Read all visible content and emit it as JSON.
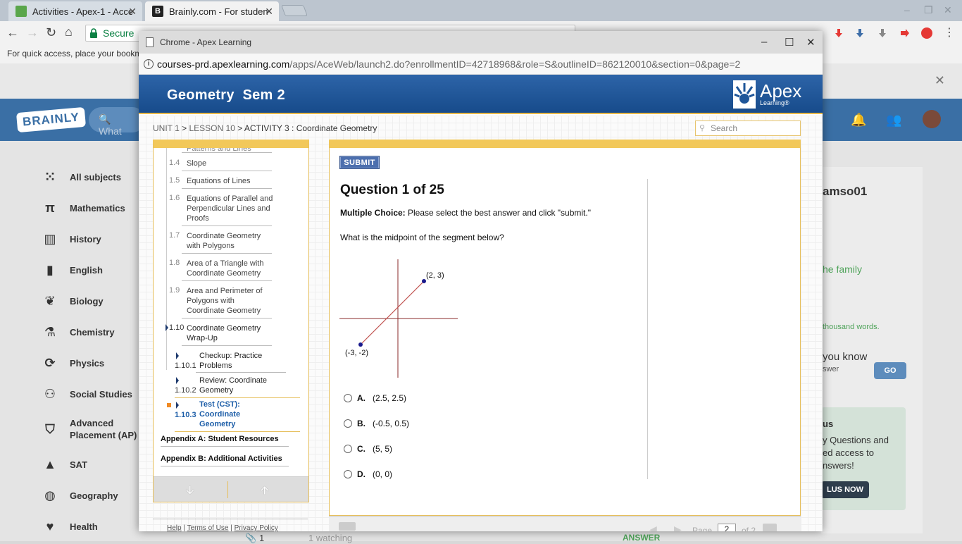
{
  "browser": {
    "tabs": [
      {
        "title": "Activities - Apex-1 - Acce",
        "favicon_color": "#5aa64b"
      },
      {
        "title": "Brainly.com - For studen",
        "favicon_color": "#222222"
      }
    ],
    "secure_label": "Secure",
    "bookmarks_hint": "For quick access, place your bookm"
  },
  "brainly": {
    "search_placeholder": "What",
    "subjects": [
      {
        "label": "All subjects",
        "icon": "grid-dots-icon"
      },
      {
        "label": "Mathematics",
        "icon": "pi-icon"
      },
      {
        "label": "History",
        "icon": "columns-icon"
      },
      {
        "label": "English",
        "icon": "book-icon"
      },
      {
        "label": "Biology",
        "icon": "leaf-icon"
      },
      {
        "label": "Chemistry",
        "icon": "flask-icon"
      },
      {
        "label": "Physics",
        "icon": "orbit-icon"
      },
      {
        "label": "Social Studies",
        "icon": "people-icon"
      },
      {
        "label": "Advanced Placement (AP)",
        "icon": "badge-icon"
      },
      {
        "label": "SAT",
        "icon": "mortarboard-icon"
      },
      {
        "label": "Geography",
        "icon": "globe-icon"
      },
      {
        "label": "Health",
        "icon": "heart-icon"
      }
    ],
    "username": "amso01",
    "family_link": "he family",
    "thousand_words": "thousand words.",
    "did_you_know": "you know",
    "answer_hint": "swer",
    "go_label": "GO",
    "promo_title": "us",
    "promo_text": "y Questions and ed access to nswers!",
    "plus_label": "LUS NOW",
    "bottom_count": "1",
    "bottom_watching": "1 watching",
    "bottom_answer": "ANSWER"
  },
  "popup": {
    "window_title": "Chrome - Apex Learning",
    "url_host": "courses-prd.apexlearning.com",
    "url_path": "/apps/AceWeb/launch2.do?enrollmentID=42718968&role=S&outlineID=862120010&section=0&page=2",
    "course_title": "Geometry  Sem 2",
    "logo_name": "Apex",
    "logo_sub": "Learning®",
    "breadcrumb": {
      "unit": "UNIT 1",
      "lesson": "LESSON 10",
      "activity": "ACTIVITY 3 : Coordinate Geometry",
      "sep": ">"
    },
    "search_placeholder": "Search",
    "outline": {
      "cut_item": "Patterns and Lines",
      "items": [
        {
          "num": "1.4",
          "label": "Slope"
        },
        {
          "num": "1.5",
          "label": "Equations of Lines"
        },
        {
          "num": "1.6",
          "label": "Equations of Parallel and Perpendicular Lines and Proofs"
        },
        {
          "num": "1.7",
          "label": "Coordinate Geometry with Polygons"
        },
        {
          "num": "1.8",
          "label": "Area of a Triangle with Coordinate Geometry"
        },
        {
          "num": "1.9",
          "label": "Area and Perimeter of Polygons with Coordinate Geometry"
        },
        {
          "num": "1.10",
          "label": "Coordinate Geometry Wrap-Up"
        }
      ],
      "subitems": [
        {
          "num": "1.10.1",
          "label": "Checkup: Practice Problems"
        },
        {
          "num": "1.10.2",
          "label": "Review: Coordinate Geometry"
        },
        {
          "num": "1.10.3",
          "label": "Test (CST): Coordinate Geometry"
        }
      ],
      "appendices": [
        "Appendix A: Student Resources",
        "Appendix B: Additional Activities"
      ]
    },
    "footer_links": [
      "Help",
      "Terms of Use",
      "Privacy Policy"
    ],
    "question": {
      "submit_label": "SUBMIT",
      "title": "Question 1 of 25",
      "instr_bold": "Multiple Choice:",
      "instr_text": " Please select the best answer and click \"submit.\"",
      "prompt": "What is the midpoint of the segment below?",
      "graph": {
        "point_a": "(2, 3)",
        "point_b": "(-3, -2)",
        "segment_color": "#c0504d",
        "point_color": "#1a1a8c"
      },
      "choices": [
        {
          "letter": "A.",
          "text": "(2.5, 2.5)"
        },
        {
          "letter": "B.",
          "text": "(-0.5, 0.5)"
        },
        {
          "letter": "C.",
          "text": "(5, 5)"
        },
        {
          "letter": "D.",
          "text": "(0, 0)"
        }
      ]
    },
    "pager": {
      "page_label": "Page",
      "page_value": "2",
      "of_label": "of 2"
    }
  }
}
